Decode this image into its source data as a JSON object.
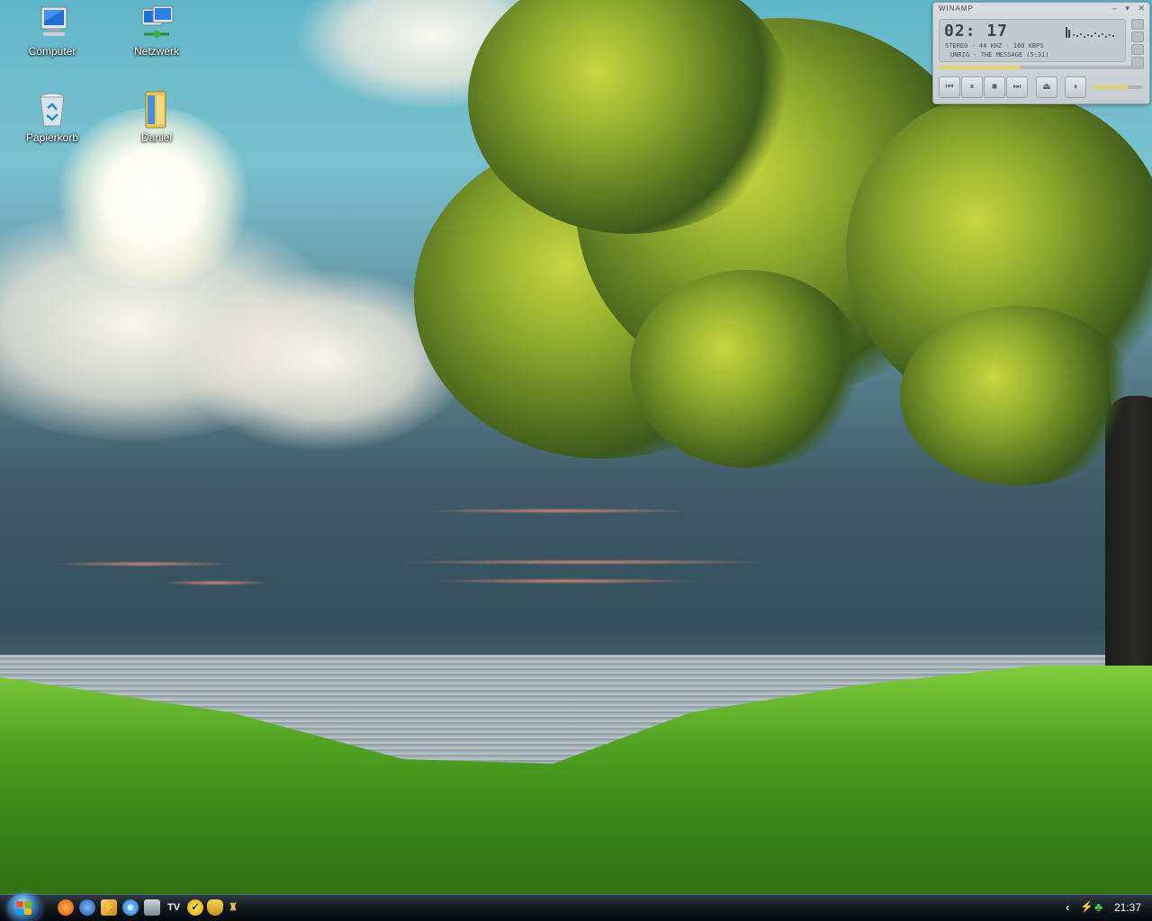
{
  "desktop": {
    "icons": [
      {
        "label": "Computer",
        "icon": "computer-icon"
      },
      {
        "label": "Netzwerk",
        "icon": "network-icon"
      },
      {
        "label": "Papierkorb",
        "icon": "recycle-bin-icon"
      },
      {
        "label": "Daniel",
        "icon": "user-folder-icon"
      }
    ]
  },
  "winamp": {
    "title": "WINAMP",
    "time": "02: 17",
    "info_line1": "STEREO - 44 KHZ - 160 KBPS",
    "info_line2": "UNRIG - THE MESSAGE (5:31)",
    "seek_fraction": 0.4,
    "volume_fraction": 0.72,
    "controls": [
      "previous-icon",
      "pause-icon",
      "stop-icon",
      "next-icon",
      "eject-icon",
      "speaker-icon"
    ]
  },
  "taskbar": {
    "start_icon": "windows-start-orb-icon",
    "quick_launch": [
      "firefox-icon",
      "thunderbird-icon",
      "winamp-icon",
      "internet-explorer-icon",
      "desktop-icon",
      "tv-icon",
      "norton-icon",
      "shield-icon",
      "trophy-icon"
    ],
    "tray_icons": [
      "chevron-left-icon",
      "winamp-tray-icon",
      "clover-icon"
    ],
    "clock": "21:37"
  }
}
